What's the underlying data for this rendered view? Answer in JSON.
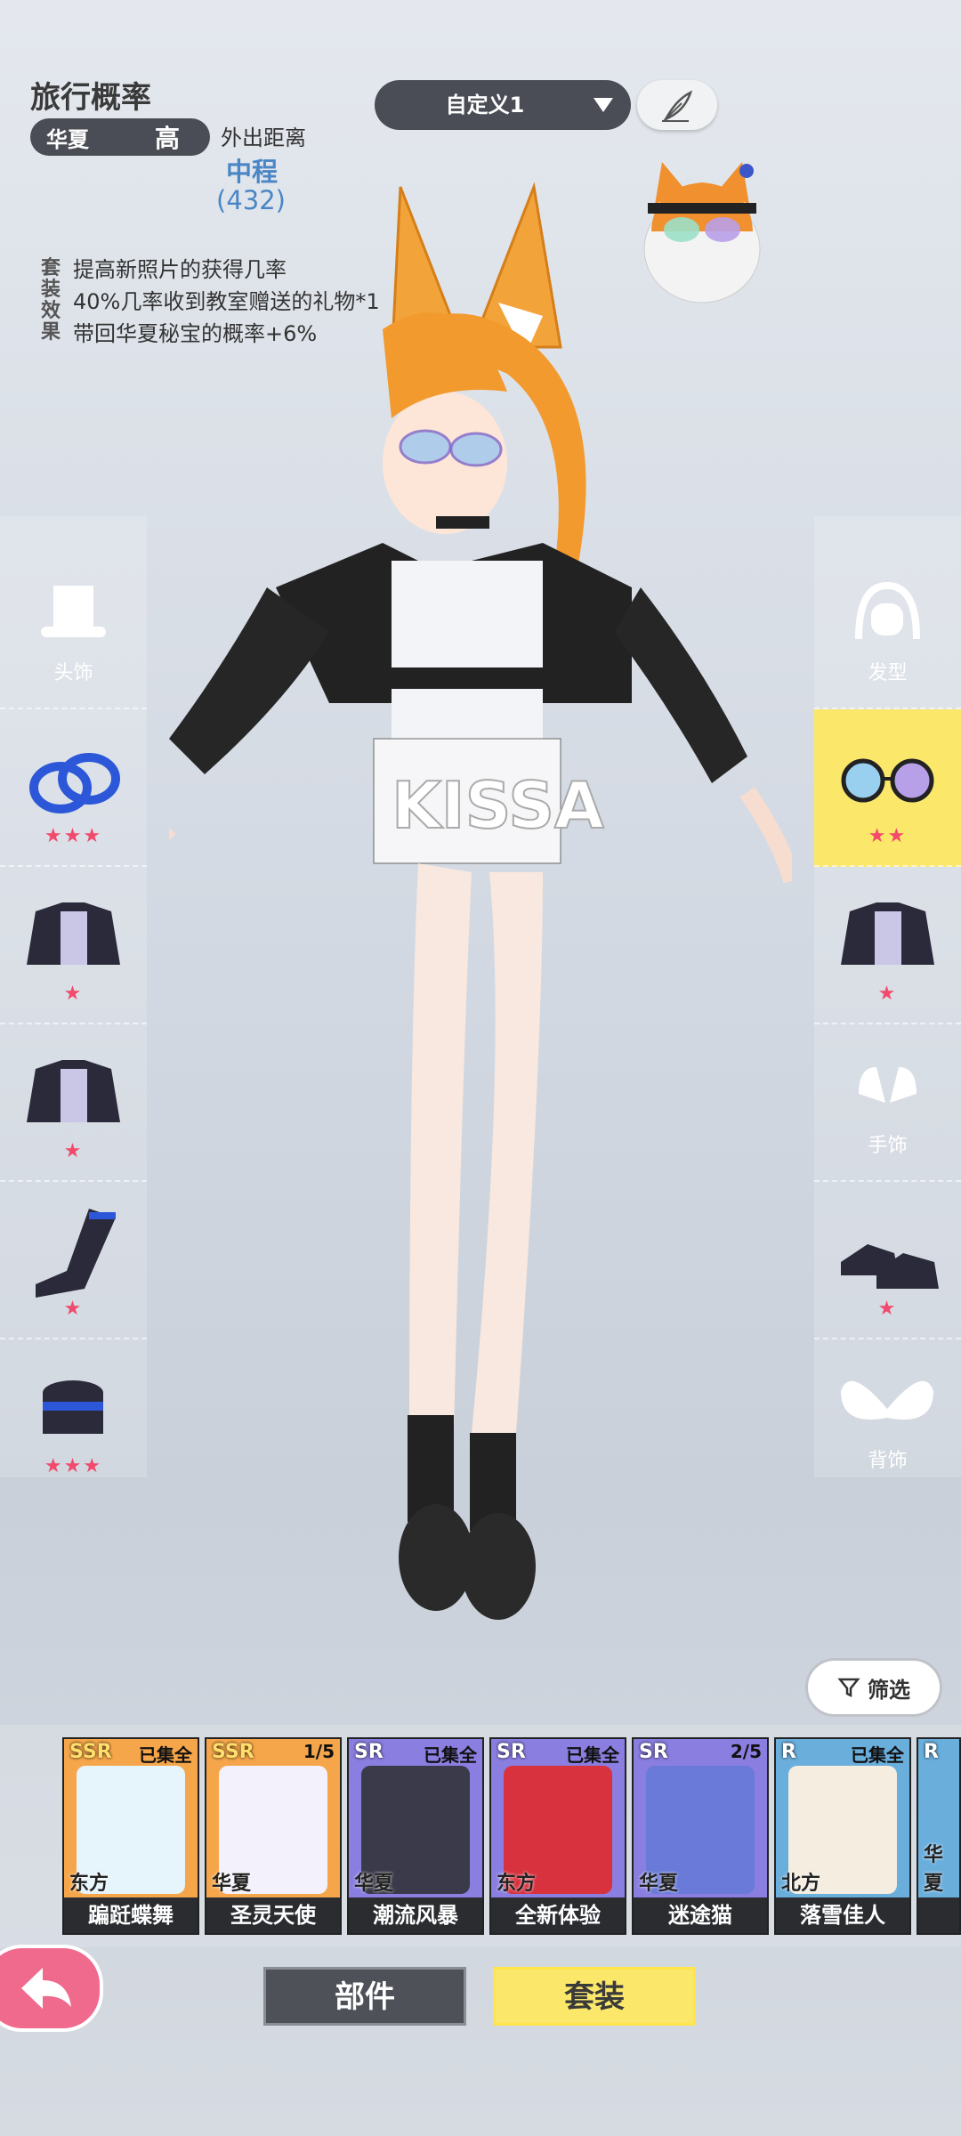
{
  "header": {
    "title": "旅行概率",
    "region": "华夏",
    "level": "高",
    "distance_label": "外出距离",
    "distance_value": "中程",
    "distance_number": "(432)"
  },
  "effects": {
    "tag": "套装效果",
    "lines": [
      "提高新照片的获得几率",
      "40%几率收到教室赠送的礼物*1",
      "带回华夏秘宝的概率+6%"
    ]
  },
  "preset": {
    "label": "自定义1"
  },
  "left_slots": [
    {
      "label": "头饰",
      "stars": ""
    },
    {
      "label": "",
      "stars": "★★★"
    },
    {
      "label": "",
      "stars": "★"
    },
    {
      "label": "",
      "stars": "★"
    },
    {
      "label": "",
      "stars": "★"
    },
    {
      "label": "",
      "stars": "★★★"
    }
  ],
  "right_slots": [
    {
      "label": "发型",
      "stars": ""
    },
    {
      "label": "",
      "stars": "★★"
    },
    {
      "label": "",
      "stars": "★"
    },
    {
      "label": "手饰",
      "stars": ""
    },
    {
      "label": "",
      "stars": "★"
    },
    {
      "label": "背饰",
      "stars": ""
    }
  ],
  "filter_label": "筛选",
  "cards": [
    {
      "rarity": "SSR",
      "status": "已集全",
      "region": "东方",
      "name": "蹁跹蝶舞",
      "color": "#f6a64a"
    },
    {
      "rarity": "SSR",
      "status": "1/5",
      "region": "华夏",
      "name": "圣灵天使",
      "color": "#f6a64a"
    },
    {
      "rarity": "SR",
      "status": "已集全",
      "region": "华夏",
      "name": "潮流风暴",
      "color": "#8a7ee0"
    },
    {
      "rarity": "SR",
      "status": "已集全",
      "region": "东方",
      "name": "全新体验",
      "color": "#8a7ee0"
    },
    {
      "rarity": "SR",
      "status": "2/5",
      "region": "华夏",
      "name": "迷途猫",
      "color": "#8a7ee0"
    },
    {
      "rarity": "R",
      "status": "已集全",
      "region": "北方",
      "name": "落雪佳人",
      "color": "#6aaedc"
    },
    {
      "rarity": "R",
      "status": "",
      "region": "华夏",
      "name": "",
      "color": "#6aaedc"
    }
  ],
  "tabs": {
    "parts": "部件",
    "suits": "套装"
  }
}
